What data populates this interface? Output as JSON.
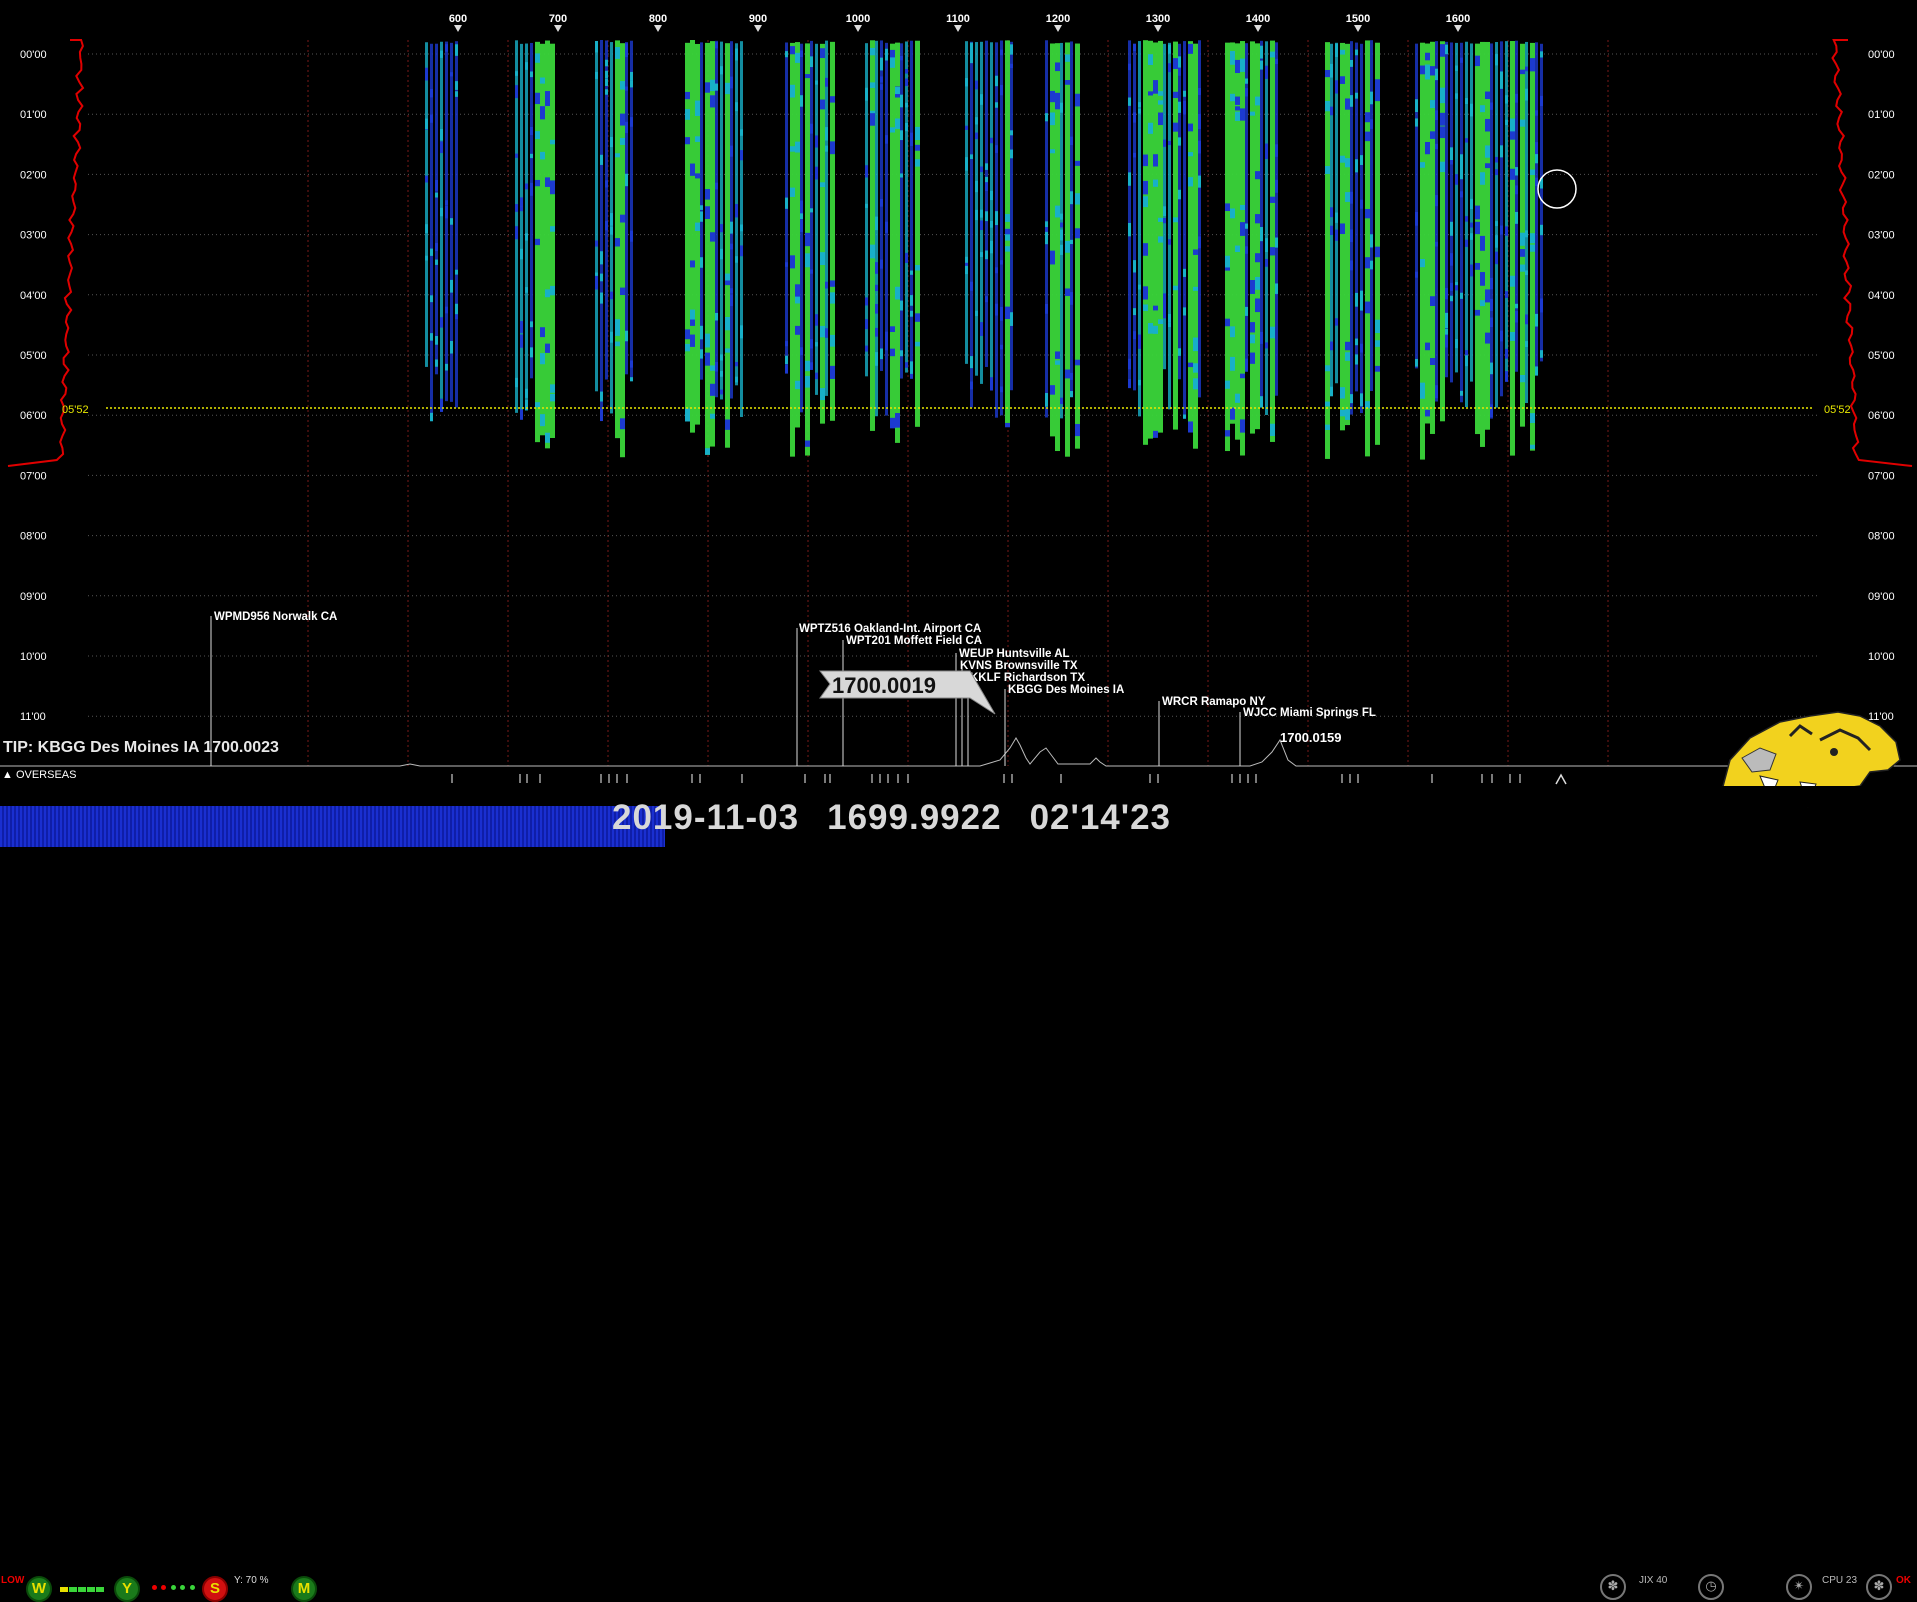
{
  "freq_axis": {
    "labels": [
      "600",
      "700",
      "800",
      "900",
      "1000",
      "1100",
      "1200",
      "1300",
      "1400",
      "1500",
      "1600"
    ]
  },
  "time_axis": {
    "labels": [
      "00'00",
      "01'00",
      "02'00",
      "03'00",
      "04'00",
      "05'00",
      "06'00",
      "07'00",
      "08'00",
      "09'00",
      "10'00",
      "11'00"
    ]
  },
  "sunrise_marker": "05'52",
  "stations": [
    {
      "label": "WPMD956 Norwalk CA"
    },
    {
      "label": "WPTZ516 Oakland-Int. Airport CA"
    },
    {
      "label": "WPT201 Moffett Field CA"
    },
    {
      "label": "WEUP Huntsville AL"
    },
    {
      "label": "KVNS Brownsville TX"
    },
    {
      "label": "KKLF Richardson TX"
    },
    {
      "label": "KBGG Des Moines IA"
    },
    {
      "label": "WRCR Ramapo NY"
    },
    {
      "label": "WJCC Miami Springs FL"
    }
  ],
  "cursor_freq_label": "1700.0019",
  "peak_freq_label": "1700.0159",
  "tip_text": "TIP: KBGG Des Moines IA 1700.0023",
  "overseas_label": "OVERSEAS",
  "status": {
    "low_label": "LOW",
    "w_label": "W",
    "y_label": "Y",
    "s_label": "S",
    "y_percent": "Y: 70 %",
    "m_label": "M",
    "jix_label": "JIX 40",
    "cpu_label": "CPU 23",
    "ok_label": "OK"
  },
  "readout": {
    "date": "2019-11-03",
    "frequency": "1699.9922",
    "time": "02'14'23"
  },
  "colors": {
    "signal_strong": "#3ad63a",
    "signal_mid": "#18b0c8",
    "signal_weak": "#1c3ad0",
    "grid_red": "#7a1a1a",
    "sunrise_yellow": "#e8e800",
    "profile_red": "#e00000",
    "status_blue": "#1a2fd0",
    "mascot_yellow": "#f2d21e"
  },
  "icons": {
    "paw": "paw-icon",
    "clock": "clock-icon",
    "tiger": "tiger-mascot-icon",
    "up_arrow": "chevron-up-icon"
  }
}
